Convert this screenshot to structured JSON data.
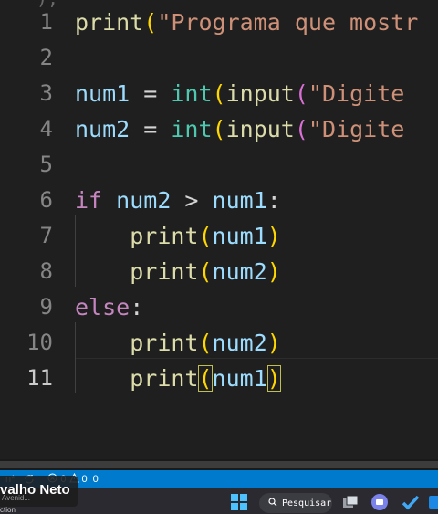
{
  "editor": {
    "top_fragment": "),",
    "lines": [
      {
        "num": "1",
        "tokens": [
          [
            "print",
            "fn"
          ],
          [
            "(",
            "p1"
          ],
          [
            "\"Programa que mostr",
            "str"
          ]
        ]
      },
      {
        "num": "2",
        "tokens": []
      },
      {
        "num": "3",
        "tokens": [
          [
            "num1",
            "var"
          ],
          [
            " = ",
            "op"
          ],
          [
            "int",
            "type"
          ],
          [
            "(",
            "p1"
          ],
          [
            "input",
            "fn"
          ],
          [
            "(",
            "p2"
          ],
          [
            "\"Digite",
            "str"
          ]
        ]
      },
      {
        "num": "4",
        "tokens": [
          [
            "num2",
            "var"
          ],
          [
            " = ",
            "op"
          ],
          [
            "int",
            "type"
          ],
          [
            "(",
            "p1"
          ],
          [
            "input",
            "fn"
          ],
          [
            "(",
            "p2"
          ],
          [
            "\"Digite",
            "str"
          ]
        ]
      },
      {
        "num": "5",
        "tokens": []
      },
      {
        "num": "6",
        "tokens": [
          [
            "if",
            "kw"
          ],
          [
            " num2 ",
            "var"
          ],
          [
            ">",
            "op"
          ],
          [
            " num1",
            "var"
          ],
          [
            ":",
            "op"
          ]
        ]
      },
      {
        "num": "7",
        "tokens": [
          [
            "    ",
            "op"
          ],
          [
            "print",
            "fn"
          ],
          [
            "(",
            "p1"
          ],
          [
            "num1",
            "var"
          ],
          [
            ")",
            "p1"
          ]
        ]
      },
      {
        "num": "8",
        "tokens": [
          [
            "    ",
            "op"
          ],
          [
            "print",
            "fn"
          ],
          [
            "(",
            "p1"
          ],
          [
            "num2",
            "var"
          ],
          [
            ")",
            "p1"
          ]
        ]
      },
      {
        "num": "9",
        "tokens": [
          [
            "else",
            "kw"
          ],
          [
            ":",
            "op"
          ]
        ]
      },
      {
        "num": "10",
        "tokens": [
          [
            "    ",
            "op"
          ],
          [
            "print",
            "fn"
          ],
          [
            "(",
            "p1"
          ],
          [
            "num2",
            "var"
          ],
          [
            ")",
            "p1"
          ]
        ]
      },
      {
        "num": "11",
        "tokens": [
          [
            "    ",
            "op"
          ],
          [
            "print",
            "fn"
          ],
          [
            "(",
            "p1"
          ],
          [
            "num1",
            "var"
          ],
          [
            ")",
            "p1"
          ]
        ]
      }
    ],
    "active_line": "11"
  },
  "statusbar": {
    "branch_fragment": "n*",
    "errors": "0",
    "warnings": "0",
    "info": "0"
  },
  "overlay": {
    "name": "valho Neto",
    "sub": "Avenid...",
    "sub2": "ction"
  },
  "taskbar": {
    "search_label": "Pesquisar"
  },
  "colors": {
    "statusbar": "#007acc",
    "editor_bg": "#1f1f1f",
    "string": "#ce9178",
    "keyword": "#c586c0",
    "function": "#dcdcaa",
    "variable": "#9cdcfe",
    "type": "#4ec9b0"
  }
}
